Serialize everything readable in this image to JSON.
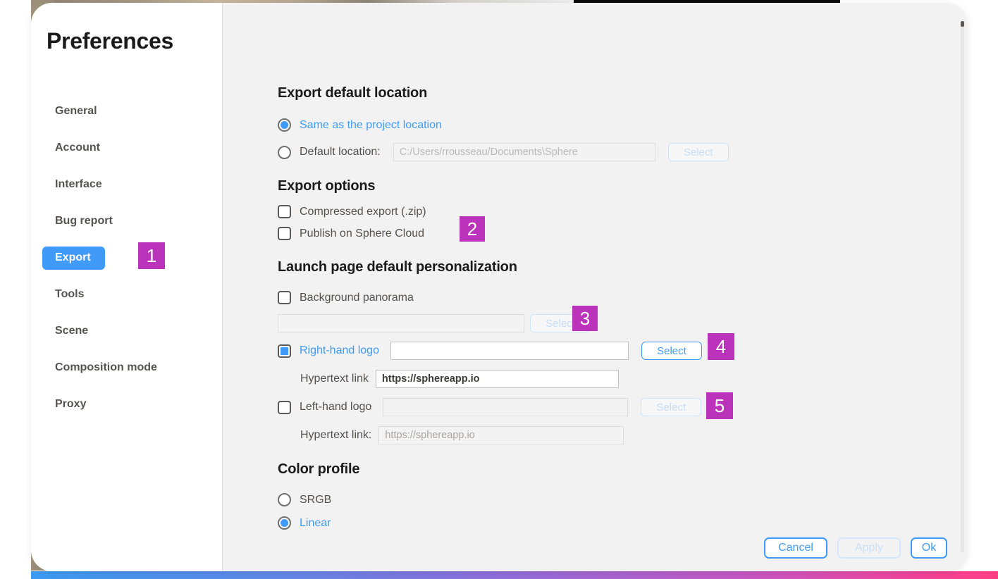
{
  "window": {
    "title": "Preferences"
  },
  "sidebar": {
    "items": [
      {
        "label": "General",
        "selected": false
      },
      {
        "label": "Account",
        "selected": false
      },
      {
        "label": "Interface",
        "selected": false
      },
      {
        "label": "Bug report",
        "selected": false
      },
      {
        "label": "Export",
        "selected": true
      },
      {
        "label": "Tools",
        "selected": false
      },
      {
        "label": "Scene",
        "selected": false
      },
      {
        "label": "Composition mode",
        "selected": false
      },
      {
        "label": "Proxy",
        "selected": false
      }
    ]
  },
  "export_location": {
    "heading": "Export default location",
    "option_same": "Same as the project location",
    "option_same_selected": true,
    "option_default": "Default location:",
    "option_default_selected": false,
    "path_value": "C:/Users/rrousseau/Documents\\Sphere",
    "path_enabled": false,
    "select_label": "Select",
    "select_enabled": false
  },
  "export_options": {
    "heading": "Export options",
    "compressed_label": "Compressed export (.zip)",
    "compressed_checked": false,
    "publish_label": "Publish on Sphere Cloud",
    "publish_checked": false
  },
  "launch_page": {
    "heading": "Launch page default personalization",
    "panorama_label": "Background panorama",
    "panorama_checked": false,
    "panorama_value": "",
    "panorama_select_label": "Select",
    "panorama_select_enabled": false,
    "right_logo_label": "Right-hand logo",
    "right_logo_checked": true,
    "right_logo_value": "",
    "right_logo_select_label": "Select",
    "right_logo_select_enabled": true,
    "right_link_label": "Hypertext link",
    "right_link_value": "https://sphereapp.io",
    "left_logo_label": "Left-hand logo",
    "left_logo_checked": false,
    "left_logo_value": "",
    "left_logo_select_label": "Select",
    "left_logo_select_enabled": false,
    "left_link_label": "Hypertext link:",
    "left_link_placeholder": "https://sphereapp.io"
  },
  "color_profile": {
    "heading": "Color profile",
    "srgb_label": "SRGB",
    "srgb_selected": false,
    "linear_label": "Linear",
    "linear_selected": true
  },
  "footer": {
    "cancel_label": "Cancel",
    "apply_label": "Apply",
    "apply_enabled": false,
    "ok_label": "Ok"
  },
  "annotations": [
    {
      "number": "1"
    },
    {
      "number": "2"
    },
    {
      "number": "3"
    },
    {
      "number": "4"
    },
    {
      "number": "5"
    }
  ],
  "colors": {
    "accent_blue": "#3f9bf7",
    "badge_magenta": "#ba33ba",
    "pane_bg": "#f2f2f2",
    "sidebar_bg": "#ffffff"
  }
}
